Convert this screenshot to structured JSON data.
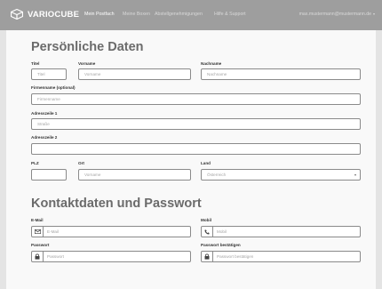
{
  "brand": {
    "name": "VARIOCUBE"
  },
  "nav": {
    "items": [
      {
        "label": "Mein Postfach",
        "active": true
      },
      {
        "label": "Meine Boxen",
        "active": false
      },
      {
        "label": "Abstellgenehmigungen",
        "active": false
      },
      {
        "label": "Hilfe & Support",
        "active": false
      }
    ],
    "user": "max.mustermann@mustermann.de"
  },
  "personal": {
    "title": "Persönliche Daten",
    "titel": {
      "label": "Titel",
      "placeholder": "Titel"
    },
    "vorname": {
      "label": "Vorname",
      "placeholder": "Vorname"
    },
    "nachname": {
      "label": "Nachname",
      "placeholder": "Nachname"
    },
    "firma": {
      "label": "Firmenname (optional)",
      "placeholder": "Firmenname"
    },
    "adresse1": {
      "label": "Adresszeile 1",
      "placeholder": "Straße"
    },
    "adresse2": {
      "label": "Adresszeile 2",
      "placeholder": ""
    },
    "plz": {
      "label": "PLZ",
      "placeholder": ""
    },
    "ort": {
      "label": "Ort",
      "placeholder": "Vorname"
    },
    "land": {
      "label": "Land",
      "value": "Österreich"
    }
  },
  "contact": {
    "title": "Kontaktdaten und Passwort",
    "email": {
      "label": "E-Mail",
      "placeholder": "E-Mail",
      "icon": "envelope-icon"
    },
    "mobil": {
      "label": "Mobil",
      "placeholder": "Mobil",
      "icon": "phone-icon"
    },
    "passwort": {
      "label": "Passwort",
      "placeholder": "Passwort",
      "icon": "lock-icon"
    },
    "passwort2": {
      "label": "Passwort bestätigen",
      "placeholder": "Passwort bestätigen",
      "icon": "lock-icon"
    }
  },
  "colors": {
    "navbar": "#9e9e9e",
    "page": "#e4e4e4",
    "card": "#f9f9f9",
    "heading": "#6b6b6b"
  }
}
